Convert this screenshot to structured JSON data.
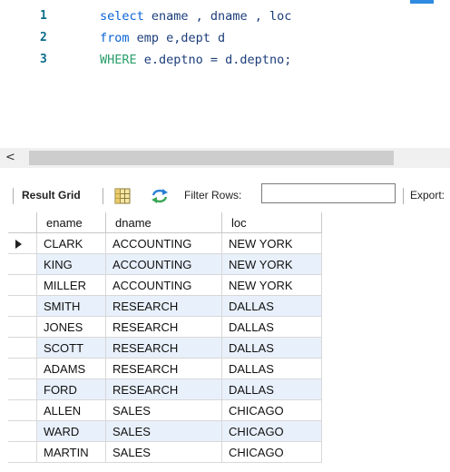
{
  "editor": {
    "lines": [
      {
        "num": "1",
        "parts": [
          {
            "t": "select",
            "c": "kw"
          },
          {
            "t": " ename , dname , loc",
            "c": "txt"
          }
        ]
      },
      {
        "num": "2",
        "parts": [
          {
            "t": "from",
            "c": "kw"
          },
          {
            "t": " emp e,dept d",
            "c": "txt"
          }
        ]
      },
      {
        "num": "3",
        "parts": [
          {
            "t": "WHERE",
            "c": "kw-green"
          },
          {
            "t": " e.deptno = d.deptno;",
            "c": "txt"
          }
        ]
      }
    ]
  },
  "scrollbar": {
    "left_arrow": "<"
  },
  "toolbar": {
    "result_grid_label": "Result Grid",
    "filter_rows_label": "Filter Rows:",
    "filter_value": "",
    "export_label": "Export:"
  },
  "grid": {
    "columns": [
      "ename",
      "dname",
      "loc"
    ],
    "rows": [
      [
        "CLARK",
        "ACCOUNTING",
        "NEW YORK"
      ],
      [
        "KING",
        "ACCOUNTING",
        "NEW YORK"
      ],
      [
        "MILLER",
        "ACCOUNTING",
        "NEW YORK"
      ],
      [
        "SMITH",
        "RESEARCH",
        "DALLAS"
      ],
      [
        "JONES",
        "RESEARCH",
        "DALLAS"
      ],
      [
        "SCOTT",
        "RESEARCH",
        "DALLAS"
      ],
      [
        "ADAMS",
        "RESEARCH",
        "DALLAS"
      ],
      [
        "FORD",
        "RESEARCH",
        "DALLAS"
      ],
      [
        "ALLEN",
        "SALES",
        "CHICAGO"
      ],
      [
        "WARD",
        "SALES",
        "CHICAGO"
      ],
      [
        "MARTIN",
        "SALES",
        "CHICAGO"
      ]
    ],
    "current_row_index": 0
  },
  "colors": {
    "keyword_blue": "#0a63d6",
    "keyword_green": "#2aa06a",
    "row_alt": "#e8f0fb",
    "accent": "#2e8be0"
  },
  "icons": [
    "grid-view-icon",
    "refresh-icon",
    "row-cursor-icon",
    "scroll-left-icon"
  ]
}
